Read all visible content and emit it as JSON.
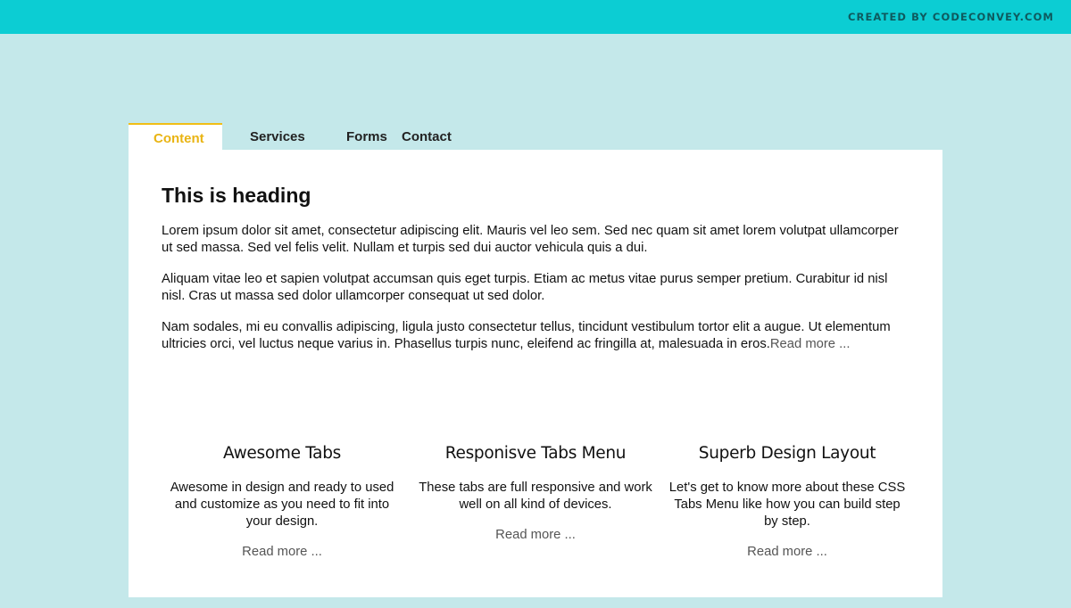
{
  "header": {
    "credit": "CREATED BY CODECONVEY.COM",
    "bar_color": "#0ccdd3"
  },
  "tabs": [
    {
      "label": "Content",
      "active": true
    },
    {
      "label": "Services",
      "active": false
    },
    {
      "label": "Forms",
      "active": false
    },
    {
      "label": "Contact",
      "active": false
    }
  ],
  "content": {
    "heading": "This is heading",
    "paragraphs": [
      "Lorem ipsum dolor sit amet, consectetur adipiscing elit. Mauris vel leo sem. Sed nec quam sit amet lorem volutpat ullamcorper ut sed massa. Sed vel felis velit. Nullam et turpis sed dui auctor vehicula quis a dui.",
      "Aliquam vitae leo et sapien volutpat accumsan quis eget turpis. Etiam ac metus vitae purus semper pretium. Curabitur id nisl nisl. Cras ut massa sed dolor ullamcorper consequat ut sed dolor.",
      "Nam sodales, mi eu convallis adipiscing, ligula justo consectetur tellus, tincidunt vestibulum tortor elit a augue. Ut elementum ultricies orci, vel luctus neque varius in. Phasellus turpis nunc, eleifend ac fringilla at, malesuada in eros."
    ],
    "read_more": "Read more ..."
  },
  "features": [
    {
      "title": "Awesome Tabs",
      "text": "Awesome in design and ready to used and customize as you need to fit into your design.",
      "link": "Read more ..."
    },
    {
      "title": "Responisve Tabs Menu",
      "text": "These tabs are full responsive and work well on all kind of devices.",
      "link": "Read more ..."
    },
    {
      "title": "Superb Design Layout",
      "text": "Let's get to know more about these CSS Tabs Menu like how you can build step by step.",
      "link": "Read more ..."
    }
  ],
  "colors": {
    "background": "#c4e8ea",
    "accent": "#f0be16"
  }
}
